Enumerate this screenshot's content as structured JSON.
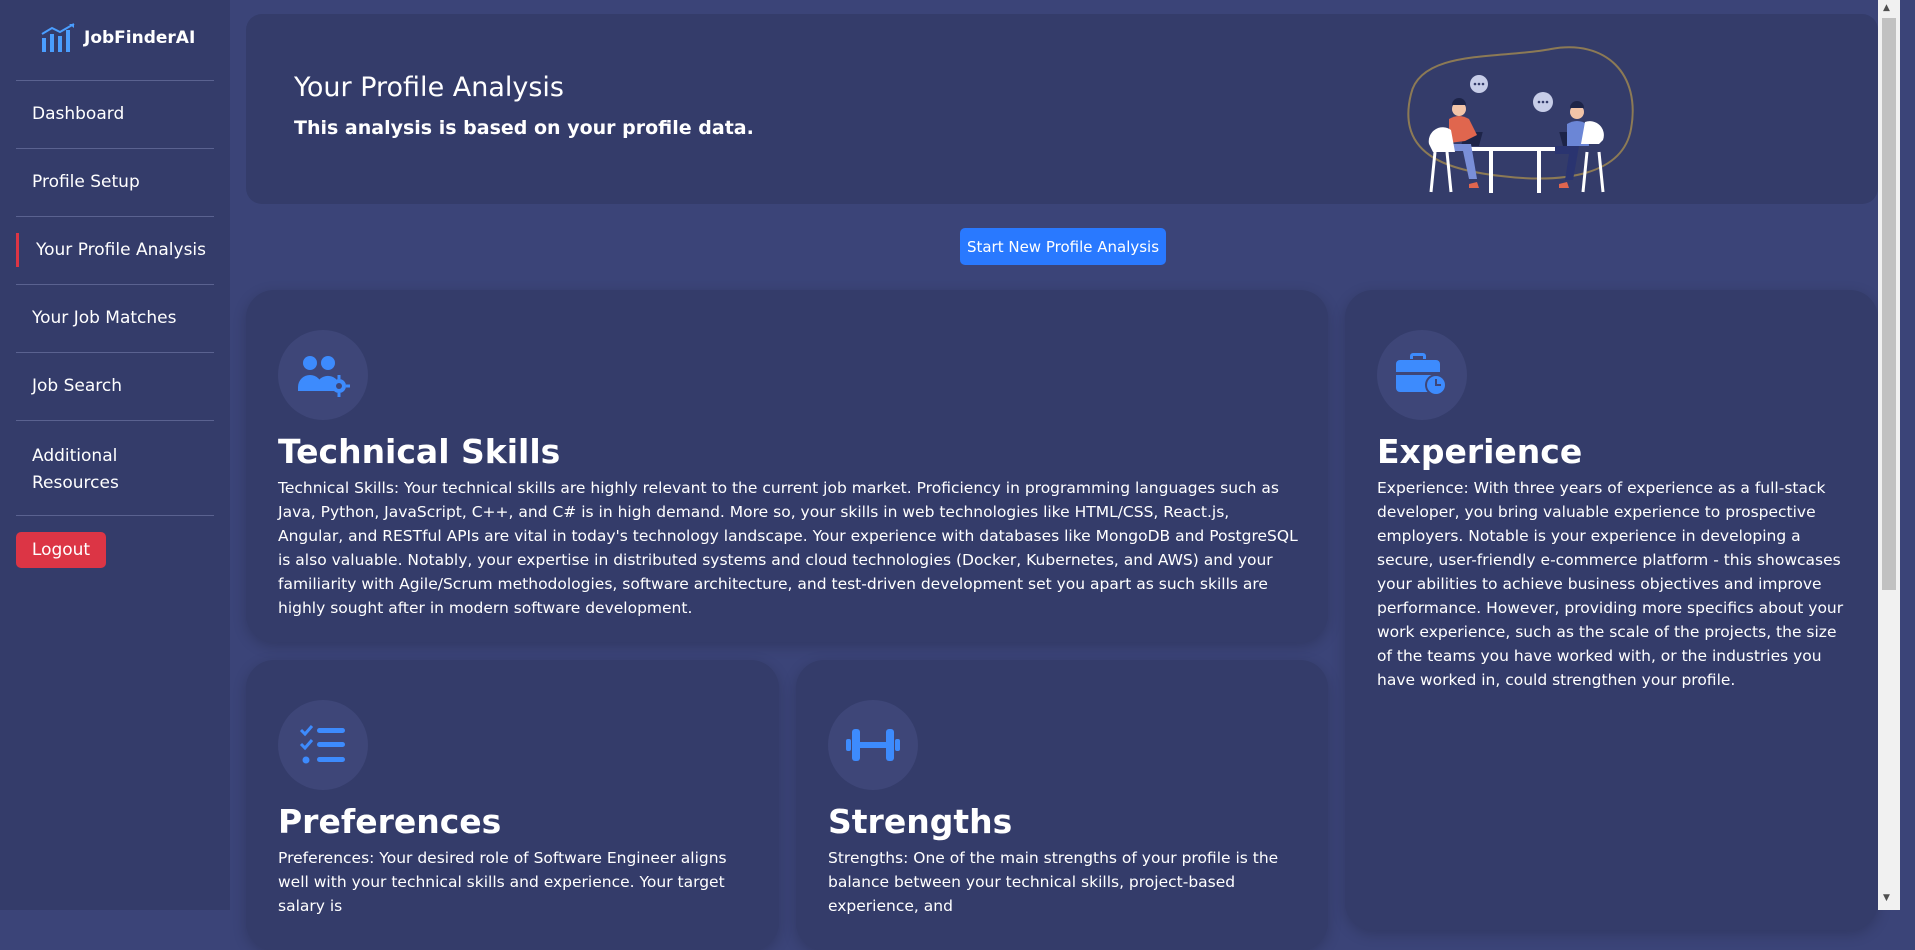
{
  "brand": {
    "name": "JobFinderAI",
    "logo_icon": "bar-chart-icon",
    "logo_color": "#4a9eff"
  },
  "sidebar": {
    "items": [
      {
        "label": "Dashboard",
        "active": false
      },
      {
        "label": "Profile Setup",
        "active": false
      },
      {
        "label": "Your Profile Analysis",
        "active": true
      },
      {
        "label": "Your Job Matches",
        "active": false
      },
      {
        "label": "Job Search",
        "active": false
      },
      {
        "label": "Additional Resources",
        "active": false
      }
    ],
    "logout_label": "Logout"
  },
  "banner": {
    "title": "Your Profile Analysis",
    "subtitle": "This analysis is based on your profile data."
  },
  "actions": {
    "start_label": "Start New Profile Analysis"
  },
  "cards": {
    "technical": {
      "icon": "users-gear-icon",
      "title": "Technical Skills",
      "text": "Technical Skills: Your technical skills are highly relevant to the current job market. Proficiency in programming languages such as Java, Python, JavaScript, C++, and C# is in high demand. More so, your skills in web technologies like HTML/CSS, React.js, Angular, and RESTful APIs are vital in today's technology landscape. Your experience with databases like MongoDB and PostgreSQL is also valuable. Notably, your expertise in distributed systems and cloud technologies (Docker, Kubernetes, and AWS) and your familiarity with Agile/Scrum methodologies, software architecture, and test-driven development set you apart as such skills are highly sought after in modern software development."
    },
    "experience": {
      "icon": "briefcase-clock-icon",
      "title": "Experience",
      "text": "Experience: With three years of experience as a full-stack developer, you bring valuable experience to prospective employers. Notable is your experience in developing a secure, user-friendly e-commerce platform - this showcases your abilities to achieve business objectives and improve performance. However, providing more specifics about your work experience, such as the scale of the projects, the size of the teams you have worked with, or the industries you have worked in, could strengthen your profile."
    },
    "preferences": {
      "icon": "checklist-icon",
      "title": "Preferences",
      "text": "Preferences: Your desired role of Software Engineer aligns well with your technical skills and experience. Your target salary is"
    },
    "strengths": {
      "icon": "dumbbell-icon",
      "title": "Strengths",
      "text": "Strengths: One of the main strengths of your profile is the balance between your technical skills, project-based experience, and"
    }
  },
  "colors": {
    "accent": "#2979ff",
    "danger": "#dc3545",
    "icon": "#3d8bfd"
  }
}
